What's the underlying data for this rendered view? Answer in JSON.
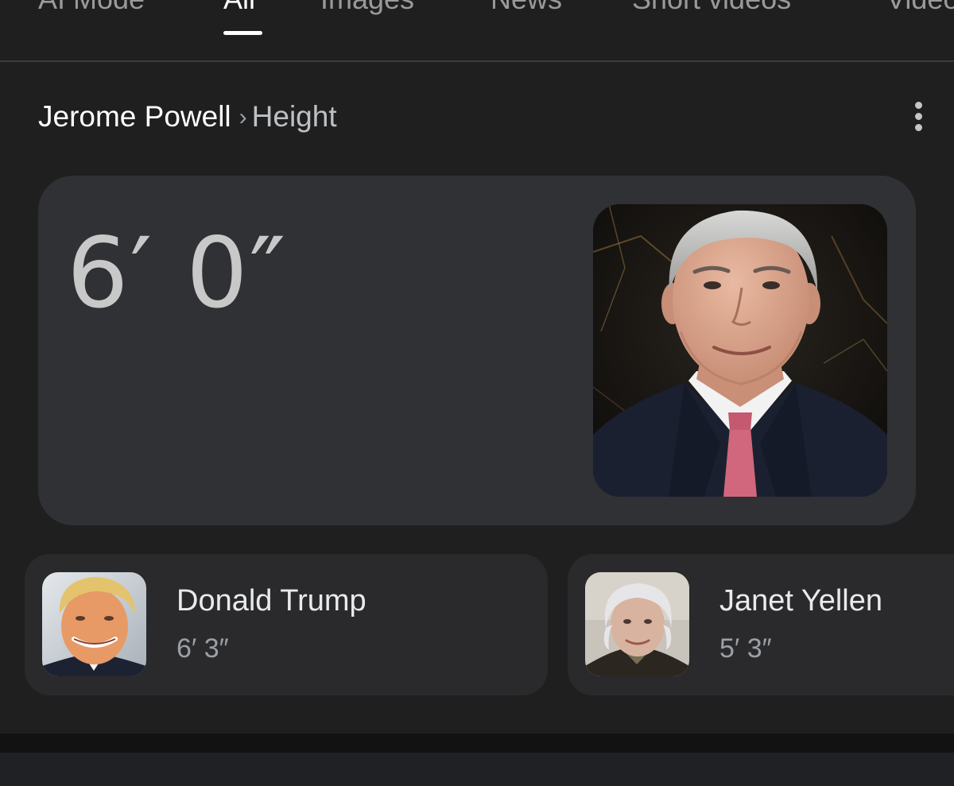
{
  "tabs": [
    {
      "label": "AI Mode"
    },
    {
      "label": "All"
    },
    {
      "label": "Images"
    },
    {
      "label": "News"
    },
    {
      "label": "Short videos"
    },
    {
      "label": "Videos"
    }
  ],
  "breadcrumb": {
    "entity": "Jerome Powell",
    "separator": "›",
    "attribute": "Height"
  },
  "answer": {
    "height": "6′ 0″",
    "image_subject": "Jerome Powell portrait"
  },
  "related": [
    {
      "name": "Donald Trump",
      "height": "6′ 3″"
    },
    {
      "name": "Janet Yellen",
      "height": "5′ 3″"
    }
  ],
  "icons": {
    "more": "more-vert-icon"
  },
  "colors": {
    "background": "#1f1f1f",
    "card": "#303134",
    "related_card": "#2a2a2c",
    "active_tab": "#ffffff",
    "inactive_tab": "#9a9a9a"
  }
}
